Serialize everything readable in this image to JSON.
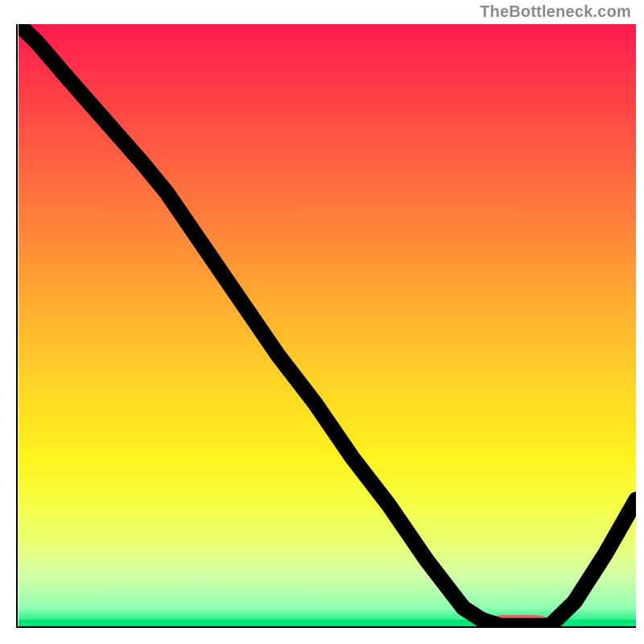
{
  "watermark": "TheBottleneck.com",
  "chart_data": {
    "type": "line",
    "title": "",
    "xlabel": "",
    "ylabel": "",
    "xlim": [
      0,
      100
    ],
    "ylim": [
      0,
      100
    ],
    "grid": false,
    "legend": false,
    "background": "heatmap-gradient-red-to-green-vertical",
    "note": "No axis tick labels or numeric labels are visible; values are read as percentages of axis range and rounded to the nearest integer.",
    "series": [
      {
        "name": "bottleneck-curve",
        "x": [
          0,
          3,
          8,
          14,
          20,
          24,
          30,
          36,
          42,
          48,
          54,
          60,
          66,
          72,
          75,
          78,
          82,
          86,
          90,
          95,
          100
        ],
        "y": [
          100,
          97,
          91,
          84,
          77,
          72,
          63,
          54,
          45,
          37,
          28,
          20,
          11,
          3,
          1,
          0,
          0,
          0,
          4,
          12,
          21
        ]
      }
    ],
    "marker": {
      "name": "optimal-range",
      "x_start": 76,
      "x_end": 86,
      "y": 0,
      "color": "#e06060",
      "shape": "rounded-bar"
    },
    "gradient_stops": [
      {
        "pos": 0.0,
        "color": "#ff1a4f"
      },
      {
        "pos": 0.12,
        "color": "#ff4047"
      },
      {
        "pos": 0.24,
        "color": "#ff6640"
      },
      {
        "pos": 0.36,
        "color": "#ff8a38"
      },
      {
        "pos": 0.48,
        "color": "#ffb22f"
      },
      {
        "pos": 0.6,
        "color": "#ffd526"
      },
      {
        "pos": 0.72,
        "color": "#fff31e"
      },
      {
        "pos": 0.8,
        "color": "#f5ff46"
      },
      {
        "pos": 0.87,
        "color": "#e8ff7a"
      },
      {
        "pos": 0.92,
        "color": "#d0ffaa"
      },
      {
        "pos": 0.97,
        "color": "#8fffb1"
      },
      {
        "pos": 1.0,
        "color": "#00e676"
      }
    ]
  }
}
